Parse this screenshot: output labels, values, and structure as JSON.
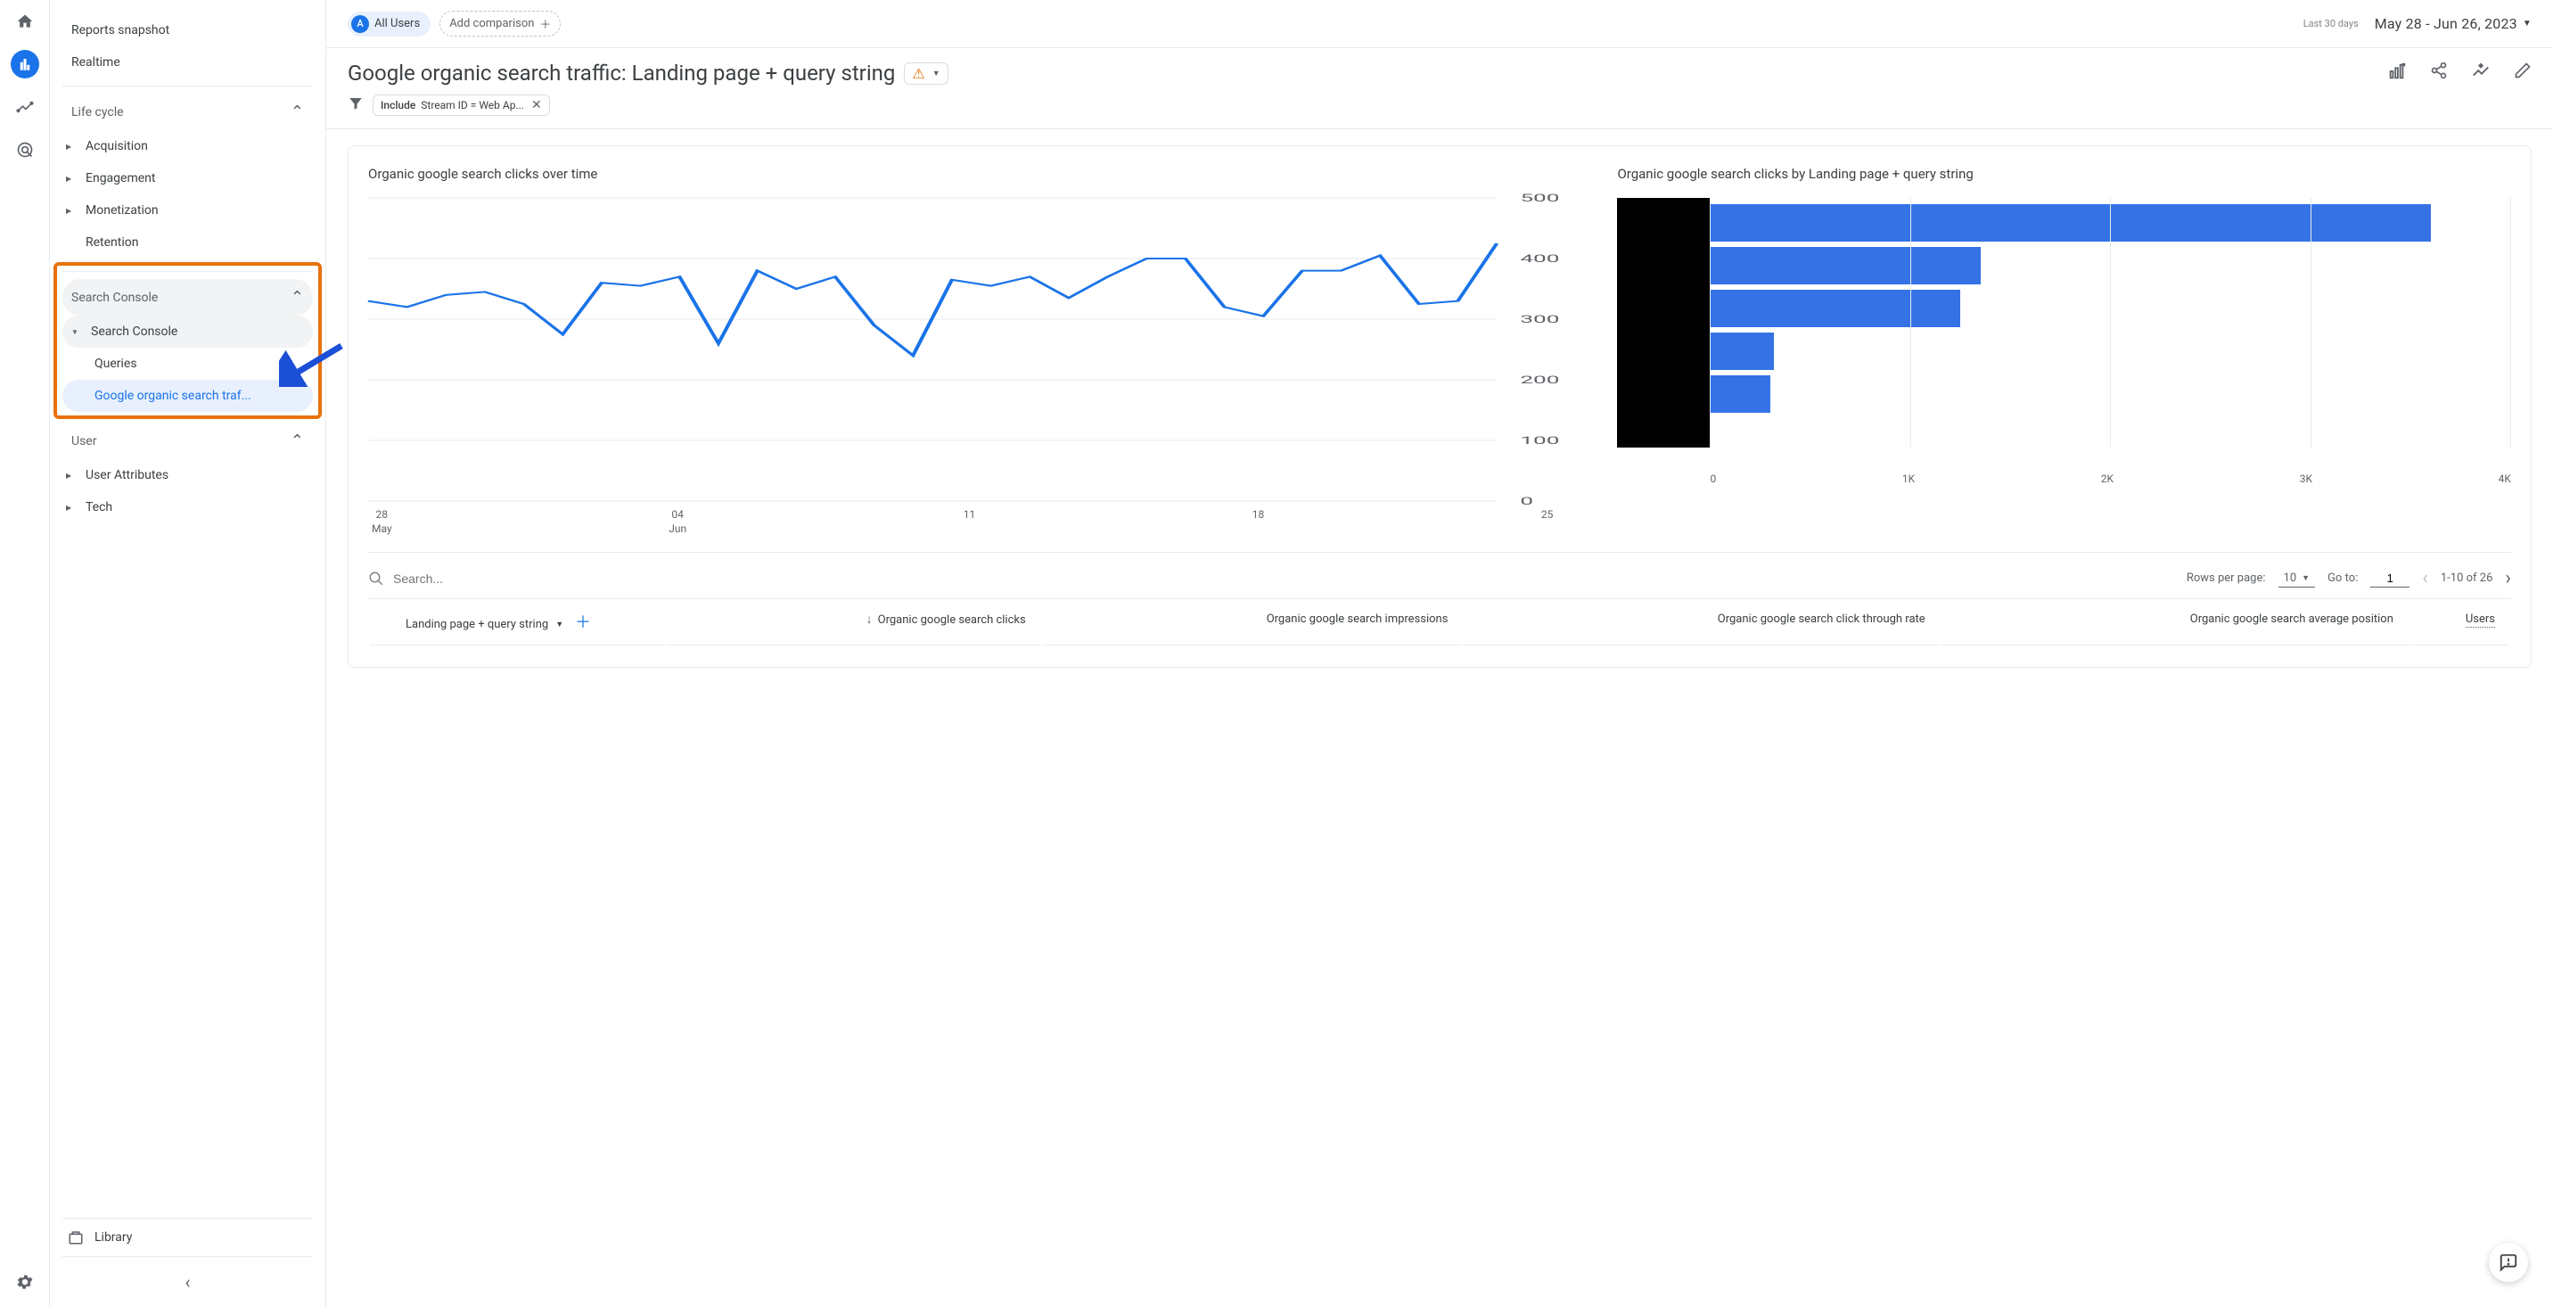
{
  "rail": {
    "items": [
      "home",
      "reports",
      "explore",
      "ads",
      "settings"
    ]
  },
  "sidebar": {
    "reports_snapshot": "Reports snapshot",
    "realtime": "Realtime",
    "life_cycle": "Life cycle",
    "acquisition": "Acquisition",
    "engagement": "Engagement",
    "monetization": "Monetization",
    "retention": "Retention",
    "search_console_group": "Search Console",
    "search_console_sub": "Search Console",
    "queries": "Queries",
    "organic_traffic": "Google organic search traf...",
    "user_group": "User",
    "user_attributes": "User Attributes",
    "tech": "Tech",
    "library": "Library"
  },
  "topbar": {
    "all_users": "All Users",
    "add_comparison": "Add comparison",
    "last_30": "Last 30 days",
    "date_range": "May 28 - Jun 26, 2023"
  },
  "title": "Google organic search traffic: Landing page + query string",
  "filter": {
    "prefix": "Include",
    "text": "Stream ID = Web Ap..."
  },
  "chart1": {
    "title": "Organic google search clicks over time"
  },
  "chart2": {
    "title": "Organic google search clicks by Landing page + query string"
  },
  "chart_data": [
    {
      "type": "line",
      "title": "Organic google search clicks over time",
      "xlabel": "",
      "ylabel": "",
      "ylim": [
        0,
        500
      ],
      "y_ticks": [
        0,
        100,
        200,
        300,
        400,
        500
      ],
      "x_ticks": [
        "28\nMay",
        "04\nJun",
        "11",
        "18",
        "25"
      ],
      "series": [
        {
          "name": "clicks",
          "values": [
            330,
            320,
            340,
            345,
            325,
            275,
            360,
            355,
            370,
            260,
            380,
            350,
            370,
            290,
            240,
            365,
            355,
            370,
            335,
            370,
            400,
            400,
            320,
            305,
            380,
            380,
            405,
            325,
            330,
            425
          ]
        }
      ]
    },
    {
      "type": "bar",
      "title": "Organic google search clicks by Landing page + query string",
      "orientation": "horizontal",
      "xlim": [
        0,
        4000
      ],
      "x_ticks": [
        "0",
        "1K",
        "2K",
        "3K",
        "4K"
      ],
      "categories": [
        "(redacted 1)",
        "(redacted 2)",
        "(redacted 3)",
        "(redacted 4)",
        "(redacted 5)"
      ],
      "values": [
        3600,
        1350,
        1250,
        320,
        300
      ]
    }
  ],
  "table_controls": {
    "search_placeholder": "Search...",
    "rows_label": "Rows per page:",
    "rows_value": "10",
    "goto_label": "Go to:",
    "goto_value": "1",
    "range": "1-10 of 26"
  },
  "table": {
    "dim_label": "Landing page + query string",
    "cols": [
      "Organic google search clicks",
      "Organic google search impressions",
      "Organic google search click through rate",
      "Organic google search average position",
      "Users"
    ]
  }
}
